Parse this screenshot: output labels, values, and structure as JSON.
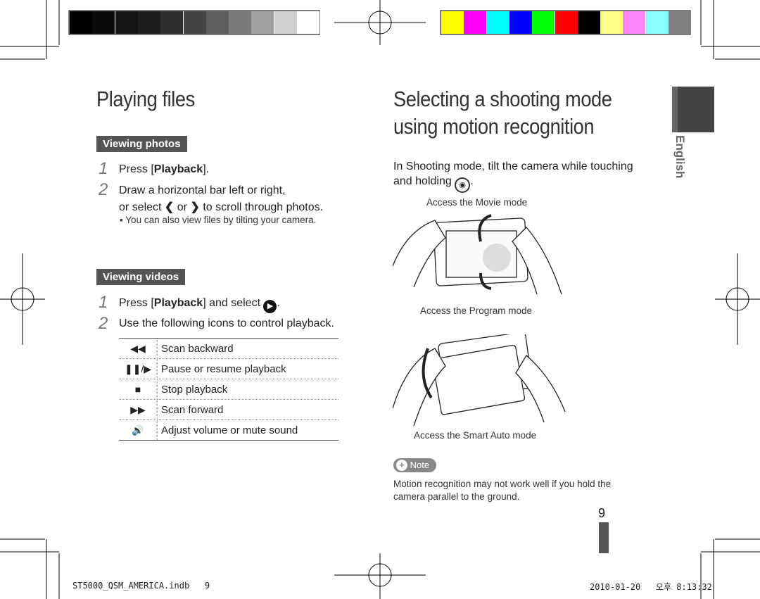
{
  "calibration": {
    "gray": [
      "#000000",
      "#0a0a0a",
      "#141414",
      "#1e1e1e",
      "#2e2e2e",
      "#444444",
      "#5e5e5e",
      "#7a7a7a",
      "#a0a0a0",
      "#cfcfcf",
      "#ffffff"
    ],
    "color": [
      "#ffff00",
      "#ff00ff",
      "#00ffff",
      "#0000ff",
      "#00ff00",
      "#ff0000",
      "#000000",
      "#ffff88",
      "#ff88ff",
      "#88ffff",
      "#808080"
    ]
  },
  "left": {
    "title": "Playing files",
    "photos": {
      "tag": "Viewing photos",
      "step1_num": "1",
      "step1_pre": "Press [",
      "step1_bold": "Playback",
      "step1_post": "].",
      "step2_num": "2",
      "step2_line1": "Draw a horizontal bar left or right,",
      "step2_line2a": "or select",
      "step2_or": "or",
      "step2_line2b": "to scroll through photos.",
      "bullet": "▪ You can also view files by tilting your camera."
    },
    "videos": {
      "tag": "Viewing videos",
      "step1_num": "1",
      "step1_pre": "Press [",
      "step1_bold": "Playback",
      "step1_post": "] and select",
      "step2_num": "2",
      "step2": "Use the following icons to control playback.",
      "rows": [
        {
          "icon": "◀◀",
          "label": "Scan backward"
        },
        {
          "icon": "❚❚/▶",
          "label": "Pause or resume playback"
        },
        {
          "icon": "■",
          "label": "Stop playback"
        },
        {
          "icon": "▶▶",
          "label": "Scan forward"
        },
        {
          "icon": "🔊",
          "label": "Adjust volume or mute sound"
        }
      ]
    }
  },
  "right": {
    "title_line1": "Selecting a shooting mode",
    "title_line2": "using motion recognition",
    "intro_line1": "In Shooting mode, tilt the camera while touching",
    "intro_line2": "and holding",
    "caption_movie": "Access the Movie mode",
    "caption_program": "Access the Program mode",
    "caption_smart": "Access the Smart Auto mode",
    "note_label": "Note",
    "note_line1": "Motion recognition may not work well if you hold the",
    "note_line2": "camera parallel to the ground."
  },
  "side_tab": "English",
  "page_number": "9",
  "footer": {
    "file": "ST5000_QSM_AMERICA.indb   9",
    "timestamp": "2010-01-20   오후 8:13:32"
  }
}
